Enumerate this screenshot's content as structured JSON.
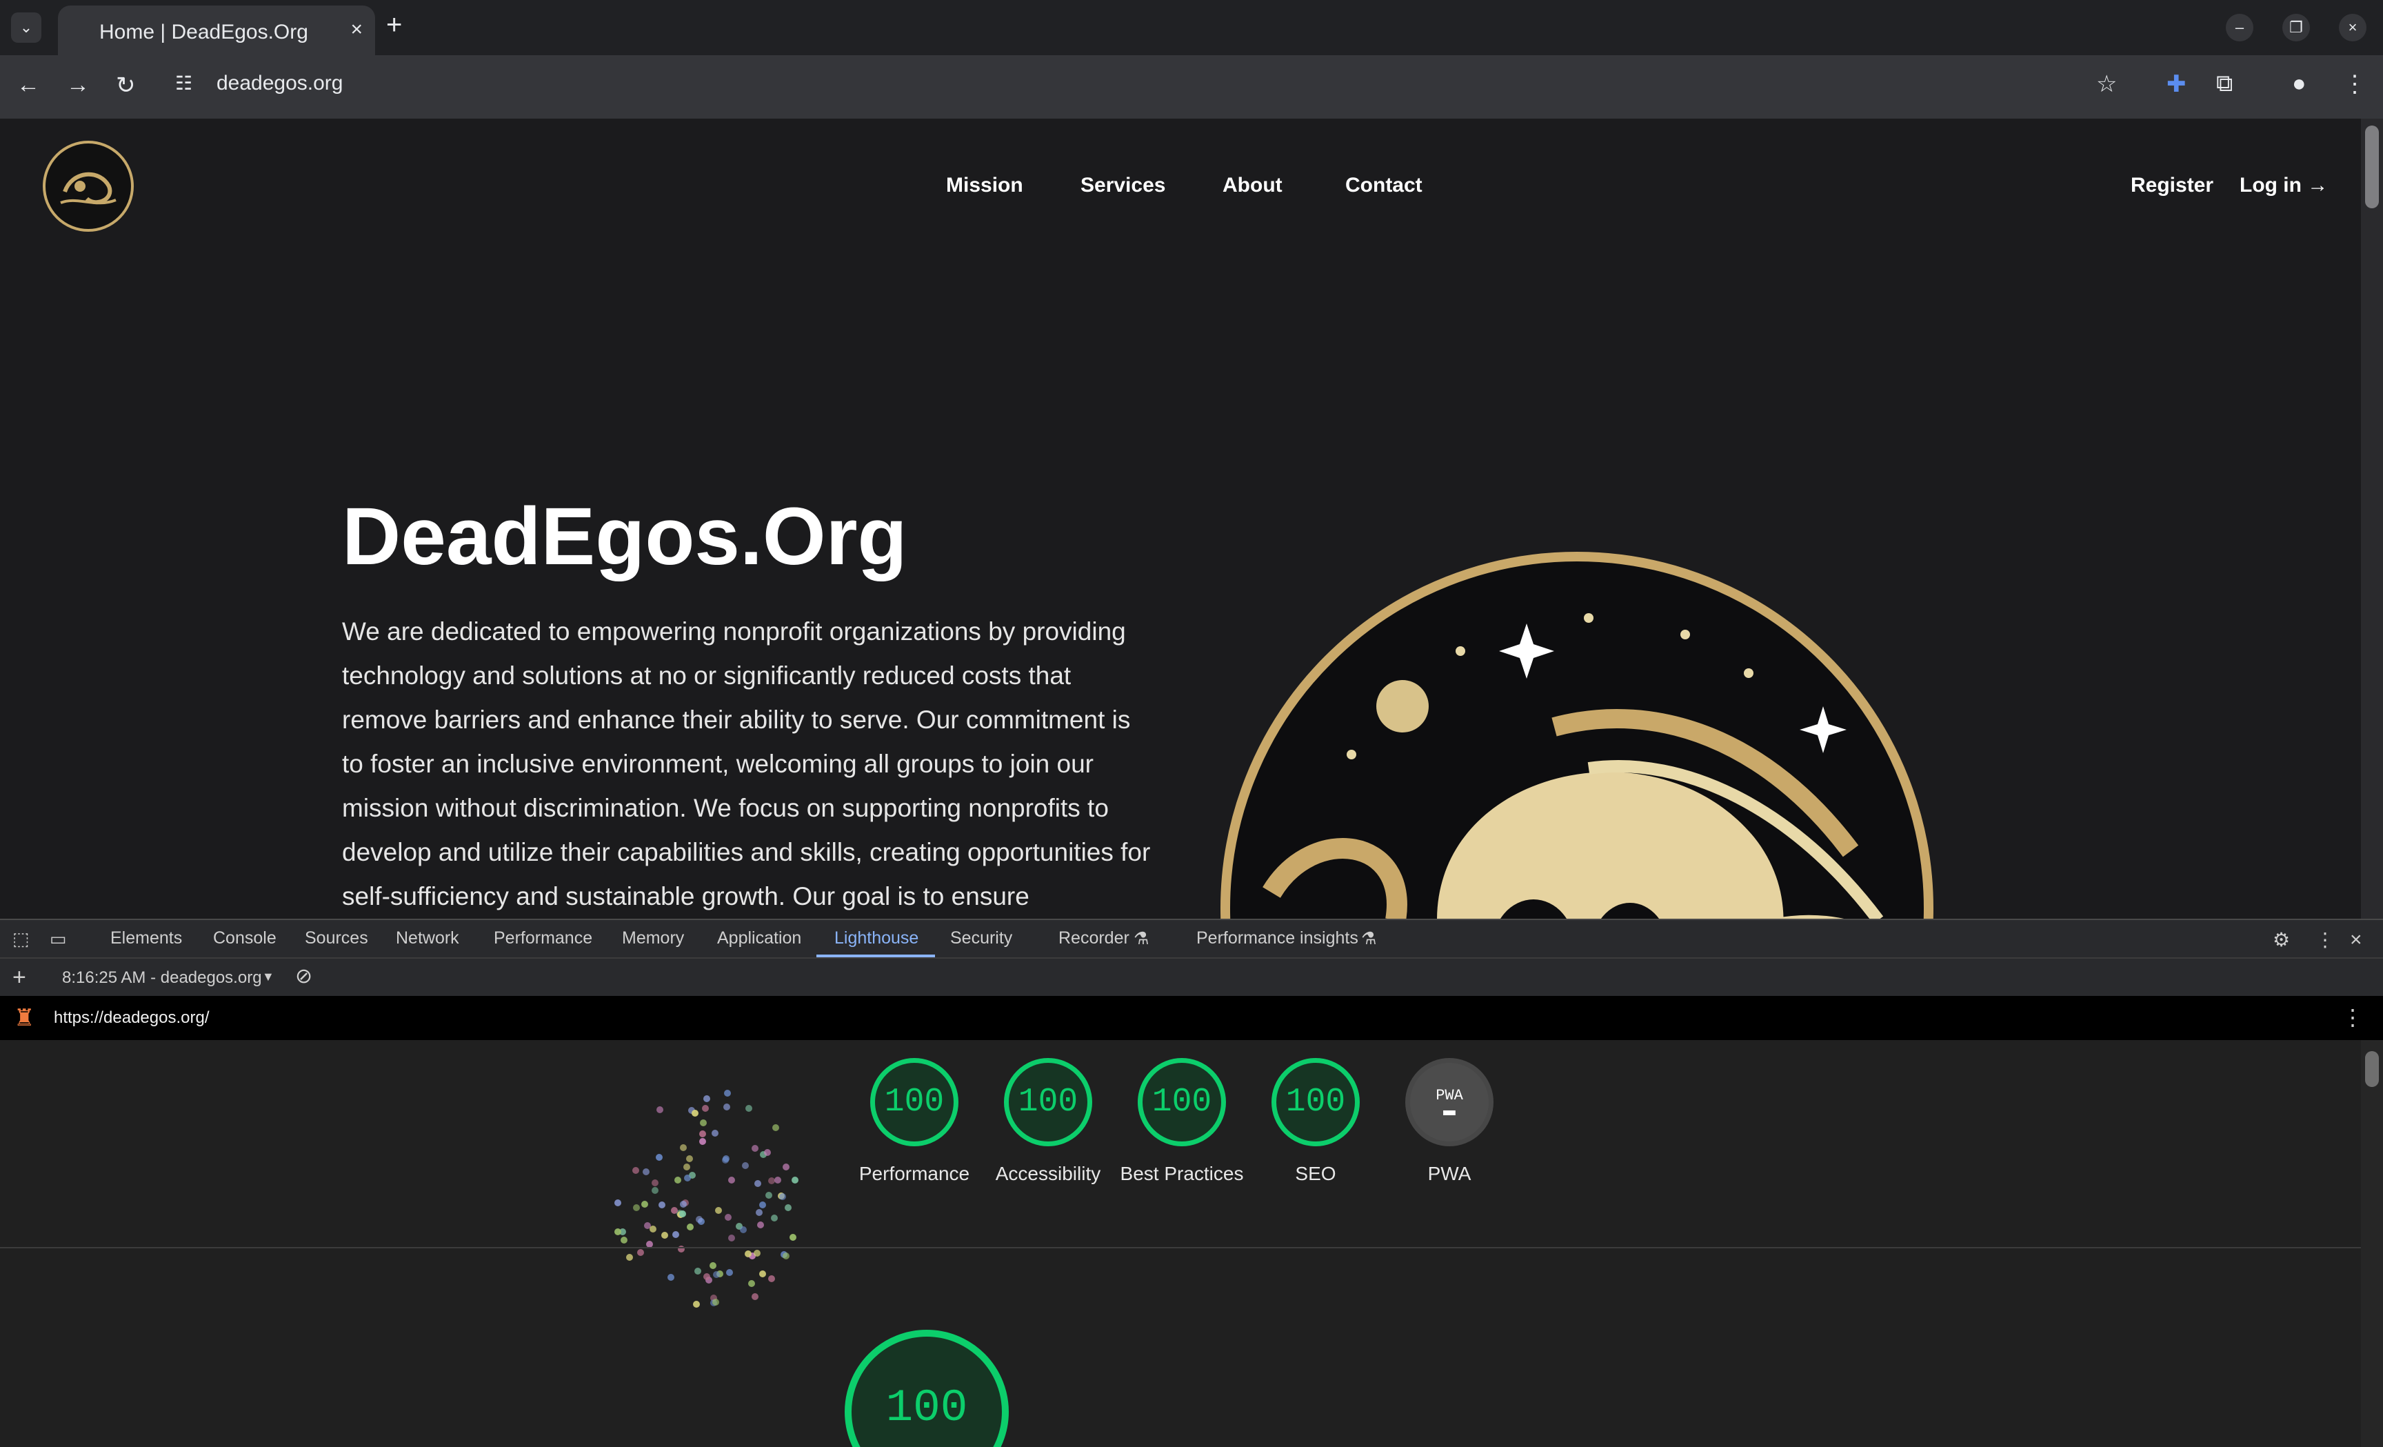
{
  "browser": {
    "tab_title": "Home | DeadEgos.Org",
    "url": "deadegos.org"
  },
  "site": {
    "nav": [
      "Mission",
      "Services",
      "About",
      "Contact"
    ],
    "register": "Register",
    "login": "Log in →",
    "hero_title": "DeadEgos.Org",
    "hero_text": "We are dedicated to empowering nonprofit organizations by providing technology and solutions at no or significantly reduced costs that remove barriers and enhance their ability to serve. Our commitment is to foster an inclusive environment, welcoming all groups to join our mission without discrimination. We focus on supporting nonprofits to develop and utilize their capabilities and skills, creating opportunities for self-sufficiency and sustainable growth. Our goal is to ensure"
  },
  "devtools": {
    "tabs": [
      "Elements",
      "Console",
      "Sources",
      "Network",
      "Performance",
      "Memory",
      "Application",
      "Lighthouse",
      "Security",
      "Recorder",
      "Performance insights"
    ],
    "active_tab": "Lighthouse",
    "report_select": "8:16:25 AM - deadegos.org",
    "report_url": "https://deadegos.org/",
    "scores": [
      {
        "label": "Performance",
        "score": "100"
      },
      {
        "label": "Accessibility",
        "score": "100"
      },
      {
        "label": "Best Practices",
        "score": "100"
      },
      {
        "label": "SEO",
        "score": "100"
      }
    ],
    "pwa_label": "PWA",
    "pwa_badge": "PWA",
    "big_score": "100",
    "score_color": "#0cce6b"
  }
}
